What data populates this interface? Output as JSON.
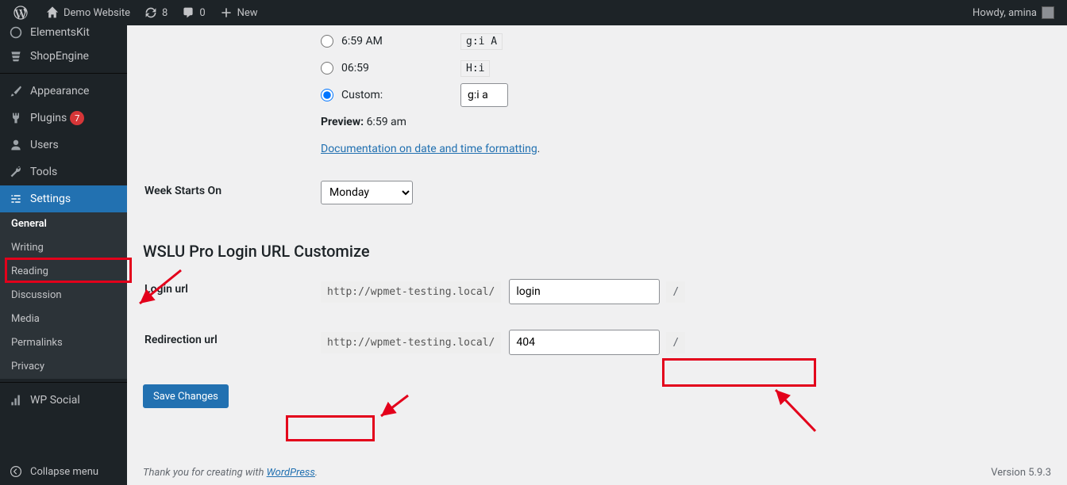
{
  "adminbar": {
    "site_title": "Demo Website",
    "updates_count": "8",
    "comments_count": "0",
    "new_label": "New",
    "howdy_prefix": "Howdy,",
    "user_name": "amina"
  },
  "sidebar": {
    "items": [
      {
        "id": "elementskit",
        "label": "ElementsKit"
      },
      {
        "id": "shopengine",
        "label": "ShopEngine"
      },
      {
        "id": "appearance",
        "label": "Appearance"
      },
      {
        "id": "plugins",
        "label": "Plugins",
        "badge": "7"
      },
      {
        "id": "users",
        "label": "Users"
      },
      {
        "id": "tools",
        "label": "Tools"
      },
      {
        "id": "settings",
        "label": "Settings"
      },
      {
        "id": "wpsocial",
        "label": "WP Social"
      }
    ],
    "settings_sub": [
      "General",
      "Writing",
      "Reading",
      "Discussion",
      "Media",
      "Permalinks",
      "Privacy"
    ],
    "collapse": "Collapse menu"
  },
  "time_format": {
    "options": [
      {
        "label": "6:59 AM",
        "code": "g:i A"
      },
      {
        "label": "06:59",
        "code": "H:i"
      }
    ],
    "custom_label": "Custom:",
    "custom_value": "g:i a",
    "preview_label": "Preview:",
    "preview_value": "6:59 am",
    "doc_link_text": "Documentation on date and time formatting"
  },
  "week": {
    "label": "Week Starts On",
    "value": "Monday"
  },
  "wslu": {
    "heading": "WSLU Pro Login URL Customize",
    "login_label": "Login url",
    "redir_label": "Redirection url",
    "url_prefix": "http://wpmet-testing.local/",
    "login_value": "login",
    "redir_value": "404",
    "suffix": "/"
  },
  "save_label": "Save Changes",
  "footer": {
    "thanks_pre": "Thank you for creating with ",
    "thanks_link": "WordPress",
    "thanks_post": ".",
    "version": "Version 5.9.3"
  }
}
